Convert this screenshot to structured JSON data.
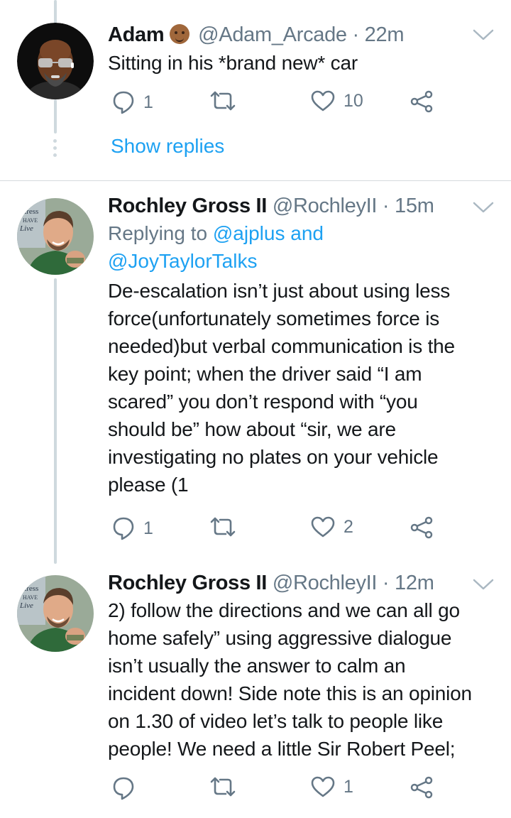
{
  "tweets": [
    {
      "name": "Adam",
      "handle": "@Adam_Arcade",
      "separator": "·",
      "time": "22m",
      "text": "Sitting in his *brand new* car",
      "replies": "1",
      "retweets": "",
      "likes": "10",
      "show_replies": "Show replies"
    },
    {
      "name": "Rochley Gross II",
      "handle": "@RochleyII",
      "separator": "·",
      "time": "15m",
      "replying_prefix": "Replying to",
      "mention1": "@ajplus",
      "and": "and",
      "mention2": "@JoyTaylorTalks",
      "lines": [
        "De-escalation isn’t just about using less",
        "force(unfortunately sometimes force is",
        "needed)but verbal communication is the",
        "key point; when the driver said “I am",
        "scared” you don’t respond with “you",
        "should be” how about “sir, we are",
        "investigating no plates on your vehicle",
        "please (1"
      ],
      "replies": "1",
      "retweets": "",
      "likes": "2"
    },
    {
      "name": "Rochley Gross II",
      "handle": "@RochleyII",
      "separator": "·",
      "time": "12m",
      "lines": [
        "2) follow the directions and we can all go",
        "home safely” using aggressive dialogue",
        "isn’t usually the answer to calm an",
        "incident down! Side note this is an opinion",
        "on 1.30 of video let’s talk to people like",
        "people! We need a little Sir Robert Peel;"
      ],
      "replies": "",
      "retweets": "",
      "likes": "1"
    }
  ],
  "avatar_signs": {
    "line1": "Stress",
    "line2": "HAVE",
    "line3": "Live"
  },
  "colors": {
    "link": "#1da1f2",
    "muted": "#657786",
    "text": "#14171a",
    "thread_line": "#cfd9de"
  }
}
